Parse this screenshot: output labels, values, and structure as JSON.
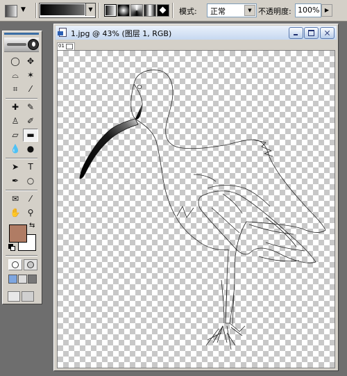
{
  "options_bar": {
    "mode_label": "模式:",
    "mode_value": "正常",
    "opacity_label": "不透明度:",
    "opacity_value": "100%",
    "gradient_types": [
      "linear",
      "radial",
      "angle",
      "reflected",
      "diamond"
    ],
    "selected_gradient_type": "linear"
  },
  "document": {
    "title": "1.jpg @ 43% (图层 1, RGB)",
    "ruler_corner_label": "01"
  },
  "toolbox": {
    "foreground_color": "#b07c64",
    "background_color": "#ffffff",
    "active_tool": "gradient-tool"
  },
  "colors": {
    "titlebar": "#c6d8f0",
    "panel": "#d4d0c8",
    "workspace": "#6e6e6e"
  }
}
